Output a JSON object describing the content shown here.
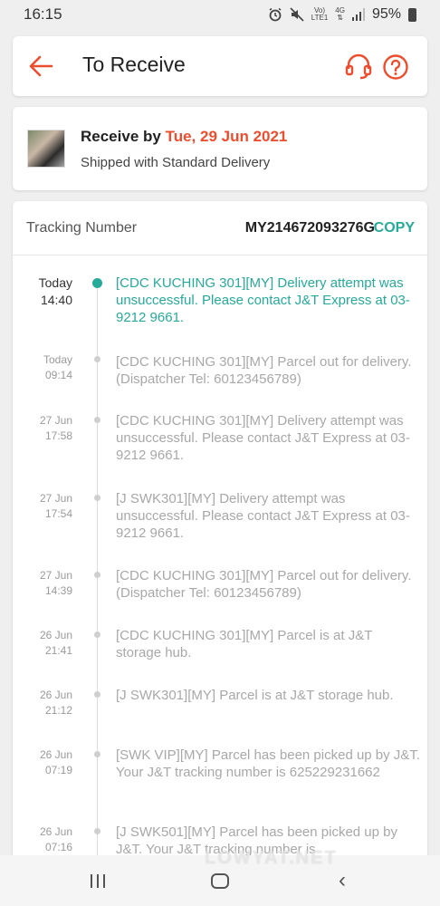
{
  "status_bar": {
    "time": "16:15",
    "battery": "95%",
    "network_top": "Vo)",
    "network_bottom": "LTE1",
    "data_top": "4G",
    "icons": [
      "alarm-icon",
      "mute-icon",
      "signal-icon",
      "battery-icon"
    ]
  },
  "header": {
    "title": "To Receive",
    "accent_color": "#ee4d2d"
  },
  "delivery": {
    "receive_by_label": "Receive by",
    "receive_date": "Tue, 29 Jun 2021",
    "shipped_with": "Shipped with Standard Delivery"
  },
  "tracking": {
    "label": "Tracking Number",
    "number": "MY214672093276G",
    "copy_label": "COPY",
    "accent_color": "#26aa99",
    "events": [
      {
        "date": "Today",
        "time": "14:40",
        "text": "[CDC KUCHING 301][MY] Delivery attempt was unsuccessful. Please contact J&T Express at 03-9212 9661."
      },
      {
        "date": "Today",
        "time": "09:14",
        "text": "[CDC KUCHING 301][MY] Parcel out for delivery. (Dispatcher Tel: 60123456789)"
      },
      {
        "date": "27 Jun",
        "time": "17:58",
        "text": "[CDC KUCHING 301][MY] Delivery attempt was unsuccessful. Please contact J&T Express at 03-9212 9661."
      },
      {
        "date": "27 Jun",
        "time": "17:54",
        "text": "[J SWK301][MY] Delivery attempt was unsuccessful. Please contact J&T Express at 03-9212 9661."
      },
      {
        "date": "27 Jun",
        "time": "14:39",
        "text": "[CDC KUCHING 301][MY] Parcel out for delivery. (Dispatcher Tel: 60123456789)"
      },
      {
        "date": "26 Jun",
        "time": "21:41",
        "text": "[CDC KUCHING 301][MY] Parcel is at J&T storage hub."
      },
      {
        "date": "26 Jun",
        "time": "21:12",
        "text": "[J SWK301][MY] Parcel is at J&T storage hub."
      },
      {
        "date": "26 Jun",
        "time": "07:19",
        "text": "[SWK VIP][MY] Parcel has been picked up by J&T. Your J&T tracking number is 625229231662"
      },
      {
        "date": "26 Jun",
        "time": "07:16",
        "text": "[J SWK501][MY] Parcel has been picked up by J&T. Your J&T tracking number is"
      }
    ]
  },
  "watermark": "LOWYAT.NET"
}
